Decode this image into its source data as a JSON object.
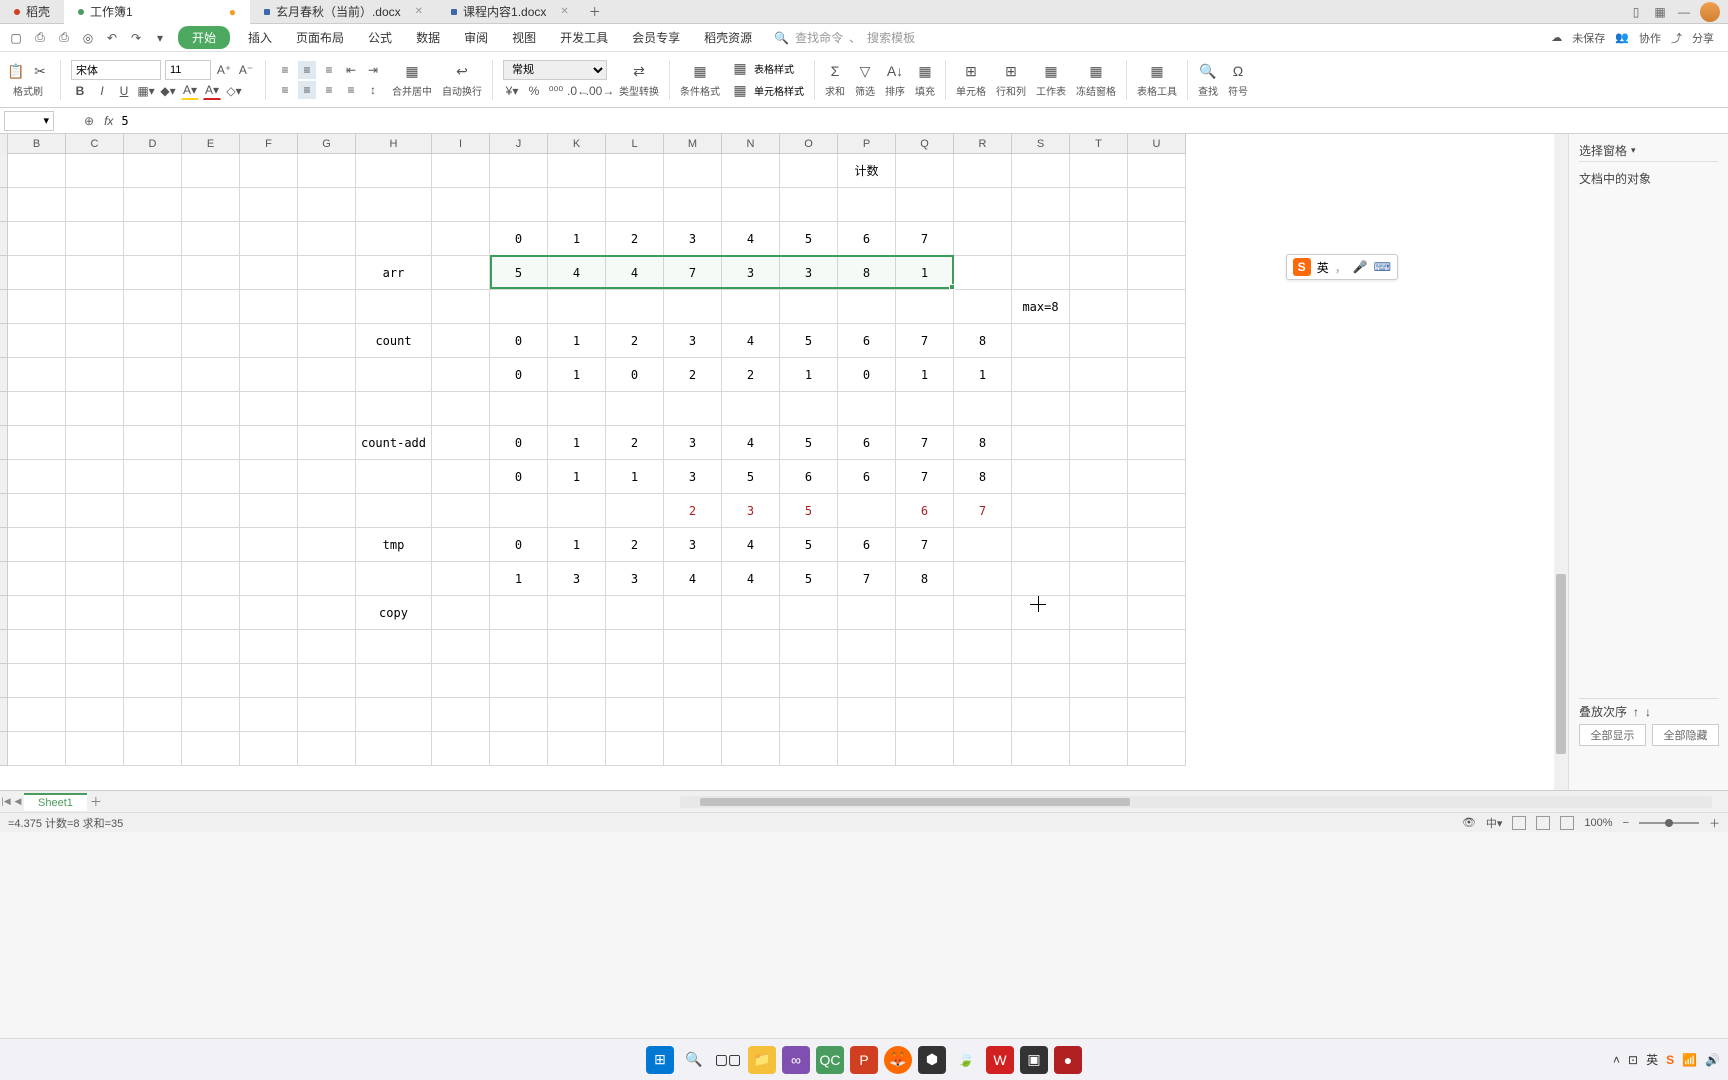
{
  "tabs": [
    {
      "label": "稻壳",
      "color": "#d04020",
      "active": false
    },
    {
      "label": "工作簿1",
      "color": "#4a9b5e",
      "active": true,
      "modified": true
    },
    {
      "label": "玄月春秋（当前）.docx",
      "color": "#3a6aa8",
      "active": false
    },
    {
      "label": "课程内容1.docx",
      "color": "#3a6aa8",
      "active": false
    }
  ],
  "menu": {
    "start": "开始",
    "items": [
      "插入",
      "页面布局",
      "公式",
      "数据",
      "审阅",
      "视图",
      "开发工具",
      "会员专享",
      "稻壳资源"
    ]
  },
  "search": {
    "placeholder1": "查找命令",
    "placeholder2": "搜索模板"
  },
  "cloud": {
    "unsaved": "未保存",
    "collab": "协作",
    "share": "分享"
  },
  "toolbar": {
    "font_name": "宋体",
    "font_size": "11",
    "paste": "格式刷",
    "general": "常规",
    "merge_center": "合并居中",
    "wrap": "自动换行",
    "convert": "类型转换",
    "cond_fmt": "条件格式",
    "table_style": "表格样式",
    "cell_style": "单元格样式",
    "sum": "求和",
    "filter": "筛选",
    "sort": "排序",
    "fill": "填充",
    "cell": "单元格",
    "rowcol": "行和列",
    "sheet": "工作表",
    "freeze": "冻结窗格",
    "table_tools": "表格工具",
    "find": "查找",
    "symbol": "符号"
  },
  "formula_bar": {
    "value": "5",
    "fx": "fx"
  },
  "side_panel": {
    "header": "选择窗格",
    "doc_objects": "文档中的对象",
    "stack_order": "叠放次序",
    "show_all": "全部显示",
    "hide_all": "全部隐藏"
  },
  "ime": {
    "lang": "英"
  },
  "columns": [
    "B",
    "C",
    "D",
    "E",
    "F",
    "G",
    "H",
    "I",
    "J",
    "K",
    "L",
    "M",
    "N",
    "O",
    "P",
    "Q",
    "R",
    "S",
    "T",
    "U"
  ],
  "col_widths": {
    "default": 58,
    "H": 76
  },
  "sheet": {
    "title_P1": "计数",
    "row_labels": {
      "arr": "arr",
      "count": "count",
      "count_add": "count-add",
      "tmp": "tmp",
      "copy": "copy"
    },
    "arr_idx": [
      "0",
      "1",
      "2",
      "3",
      "4",
      "5",
      "6",
      "7"
    ],
    "arr_val": [
      "5",
      "4",
      "4",
      "7",
      "3",
      "3",
      "8",
      "1"
    ],
    "max_label": "max=8",
    "count_idx": [
      "0",
      "1",
      "2",
      "3",
      "4",
      "5",
      "6",
      "7",
      "8"
    ],
    "count_val": [
      "0",
      "1",
      "0",
      "2",
      "2",
      "1",
      "0",
      "1",
      "1"
    ],
    "countadd_idx": [
      "0",
      "1",
      "2",
      "3",
      "4",
      "5",
      "6",
      "7",
      "8"
    ],
    "countadd_val": [
      "0",
      "1",
      "1",
      "3",
      "5",
      "6",
      "6",
      "7",
      "8"
    ],
    "countadd_red": [
      "",
      "",
      "",
      "2",
      "3",
      "5",
      "",
      "6",
      "7"
    ],
    "tmp_idx": [
      "0",
      "1",
      "2",
      "3",
      "4",
      "5",
      "6",
      "7"
    ],
    "tmp_val": [
      "1",
      "3",
      "3",
      "4",
      "4",
      "5",
      "7",
      "8"
    ]
  },
  "sheet_tabs": {
    "name": "Sheet1"
  },
  "status": {
    "avg": "=4.375  计数=8  求和=35",
    "zoom": "100%"
  },
  "taskbar_icons": [
    "windows",
    "search",
    "tasks",
    "explorer",
    "vstudio",
    "qc",
    "ppt",
    "firefox",
    "app1",
    "leaf",
    "wps",
    "app2",
    "rec"
  ]
}
